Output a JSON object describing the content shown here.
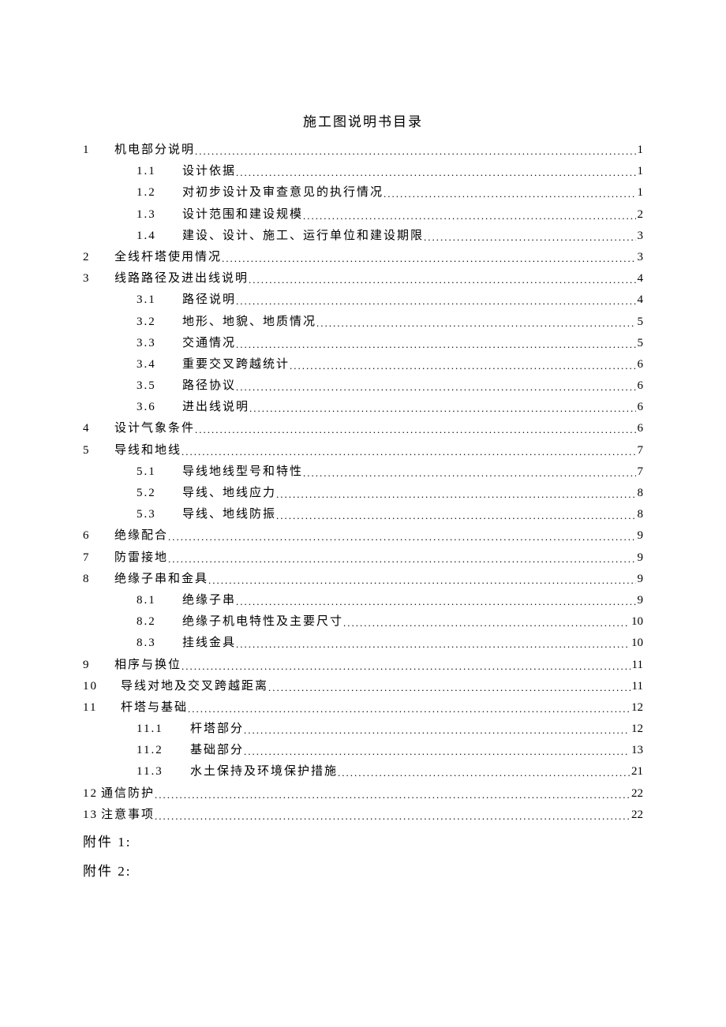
{
  "title": "施工图说明书目录",
  "toc": [
    {
      "num": "1",
      "label": "机电部分说明",
      "page": "1",
      "level": 1,
      "sub": [
        {
          "num": "1.1",
          "label": "设计依据",
          "page": "1"
        },
        {
          "num": "1.2",
          "label": "对初步设计及审查意见的执行情况",
          "page": "1"
        },
        {
          "num": "1.3",
          "label": "设计范围和建设规模",
          "page": "2"
        },
        {
          "num": "1.4",
          "label": "建设、设计、施工、运行单位和建设期限",
          "page": "3"
        }
      ]
    },
    {
      "num": "2",
      "label": "全线杆塔使用情况",
      "page": "3",
      "level": 1,
      "sub": []
    },
    {
      "num": "3",
      "label": "线路路径及进出线说明",
      "page": "4",
      "level": 1,
      "sub": [
        {
          "num": "3.1",
          "label": "路径说明",
          "page": "4"
        },
        {
          "num": "3.2",
          "label": "地形、地貌、地质情况",
          "page": "5"
        },
        {
          "num": "3.3",
          "label": "交通情况",
          "page": "5"
        },
        {
          "num": "3.4",
          "label": "重要交叉跨越统计",
          "page": "6"
        },
        {
          "num": "3.5",
          "label": "路径协议",
          "page": "6"
        },
        {
          "num": "3.6",
          "label": "进出线说明",
          "page": "6"
        }
      ]
    },
    {
      "num": "4",
      "label": "设计气象条件",
      "page": "6",
      "level": 1,
      "sub": []
    },
    {
      "num": "5",
      "label": "导线和地线",
      "page": "7",
      "level": 1,
      "sub": [
        {
          "num": "5.1",
          "label": "导线地线型号和特性",
          "page": "7"
        },
        {
          "num": "5.2",
          "label": "导线、地线应力",
          "page": "8"
        },
        {
          "num": "5.3",
          "label": "导线、地线防振",
          "page": "8"
        }
      ]
    },
    {
      "num": "6",
      "label": "绝缘配合",
      "page": "9",
      "level": 1,
      "sub": []
    },
    {
      "num": "7",
      "label": "防雷接地",
      "page": "9",
      "level": 1,
      "sub": []
    },
    {
      "num": "8",
      "label": "绝缘子串和金具",
      "page": "9",
      "level": 1,
      "sub": [
        {
          "num": "8.1",
          "label": "绝缘子串",
          "page": "9"
        },
        {
          "num": "8.2",
          "label": "绝缘子机电特性及主要尺寸",
          "page": "10"
        },
        {
          "num": "8.3",
          "label": "挂线金具",
          "page": "10"
        }
      ]
    },
    {
      "num": "9",
      "label": "相序与换位",
      "page": "11",
      "level": 1,
      "sub": []
    },
    {
      "num": "10",
      "label": "导线对地及交叉跨越距离",
      "page": "11",
      "level": 1,
      "wide": true,
      "sub": []
    },
    {
      "num": "11",
      "label": "杆塔与基础",
      "page": "12",
      "level": 1,
      "wide": true,
      "sub": [
        {
          "num": "11.1",
          "label": "杆塔部分",
          "page": "12",
          "wide": true
        },
        {
          "num": "11.2",
          "label": "基础部分",
          "page": "13",
          "wide": true
        },
        {
          "num": "11.3",
          "label": "水土保持及环境保护措施",
          "page": "21",
          "wide": true
        }
      ]
    },
    {
      "num": "12",
      "label": "通信防护",
      "page": "22",
      "level": 1,
      "nogap": true,
      "sub": []
    },
    {
      "num": "13",
      "label": "注意事项",
      "page": "22",
      "level": 1,
      "nogap": true,
      "sub": []
    }
  ],
  "appendices": [
    "附件 1:",
    "附件 2:"
  ]
}
